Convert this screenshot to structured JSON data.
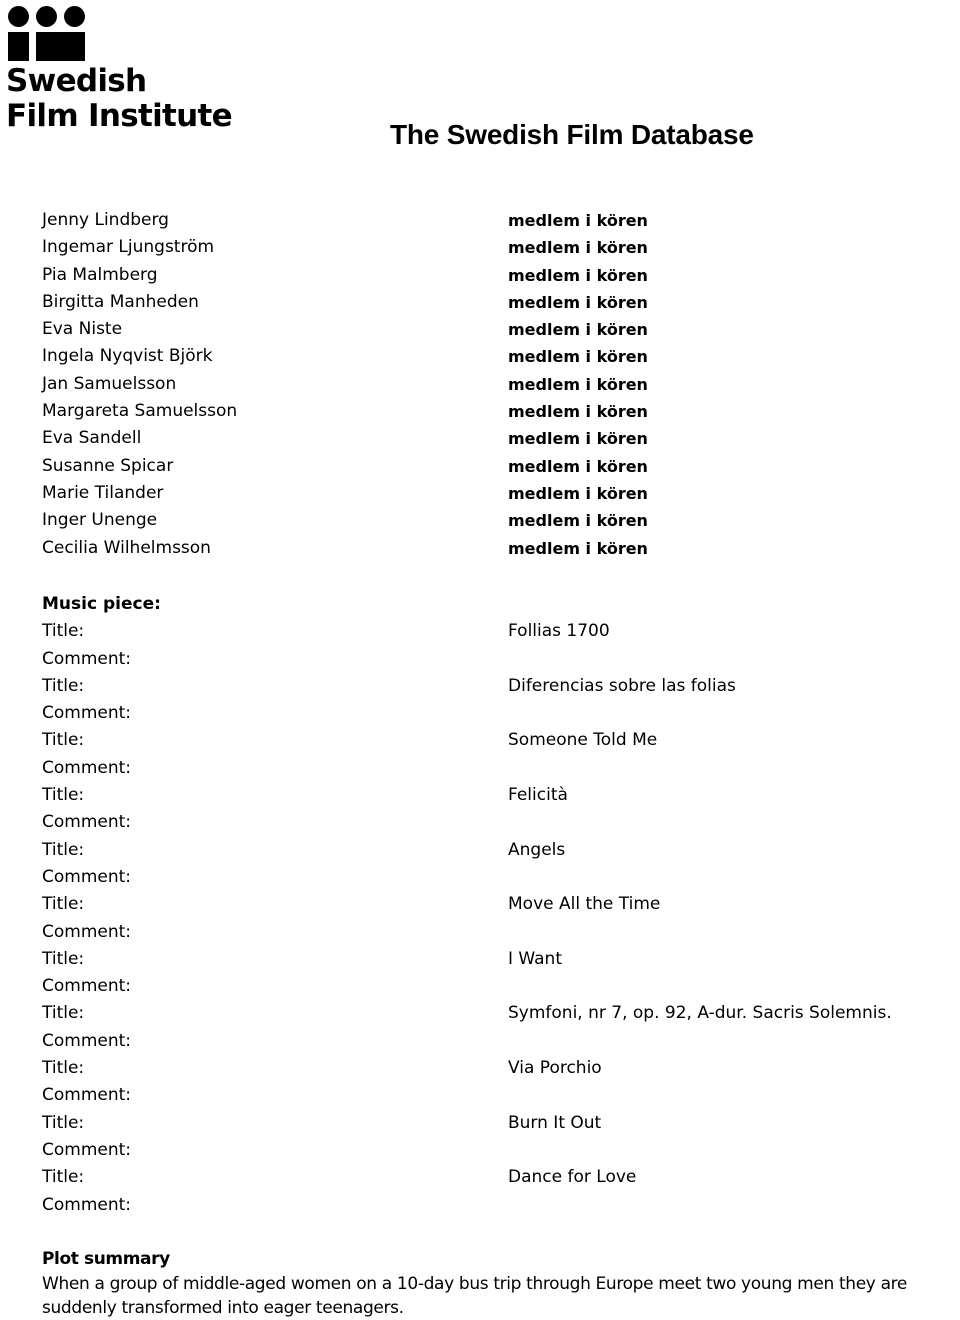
{
  "header": {
    "title": "The Swedish Film Database",
    "logo": {
      "name": "swedish-film-institute-logo",
      "line1": "Swedish",
      "line2": "Film Institute"
    }
  },
  "credits": {
    "rows": [
      {
        "name": "Jenny Lindberg",
        "role": "medlem i kören"
      },
      {
        "name": "Ingemar Ljungström",
        "role": "medlem i kören"
      },
      {
        "name": "Pia Malmberg",
        "role": "medlem i kören"
      },
      {
        "name": "Birgitta Manheden",
        "role": "medlem i kören"
      },
      {
        "name": "Eva Niste",
        "role": "medlem i kören"
      },
      {
        "name": "Ingela Nyqvist Björk",
        "role": "medlem i kören"
      },
      {
        "name": "Jan Samuelsson",
        "role": "medlem i kören"
      },
      {
        "name": "Margareta Samuelsson",
        "role": "medlem i kören"
      },
      {
        "name": "Eva Sandell",
        "role": "medlem i kören"
      },
      {
        "name": "Susanne Spicar",
        "role": "medlem i kören"
      },
      {
        "name": "Marie Tilander",
        "role": "medlem i kören"
      },
      {
        "name": "Inger Unenge",
        "role": "medlem i kören"
      },
      {
        "name": "Cecilia Wilhelmsson",
        "role": "medlem i kören"
      }
    ]
  },
  "music": {
    "heading": "Music piece:",
    "title_label": "Title:",
    "comment_label": "Comment:",
    "pieces": [
      {
        "title": "Follias 1700",
        "comment": ""
      },
      {
        "title": "Diferencias sobre las folias",
        "comment": ""
      },
      {
        "title": "Someone Told Me",
        "comment": ""
      },
      {
        "title": "Felicità",
        "comment": ""
      },
      {
        "title": "Angels",
        "comment": ""
      },
      {
        "title": "Move All the Time",
        "comment": ""
      },
      {
        "title": "I Want",
        "comment": ""
      },
      {
        "title": "Symfoni, nr 7, op. 92, A-dur. Sacris Solemnis.",
        "comment": ""
      },
      {
        "title": "Via Porchio",
        "comment": ""
      },
      {
        "title": "Burn It Out",
        "comment": ""
      },
      {
        "title": "Dance for Love",
        "comment": ""
      }
    ]
  },
  "plot": {
    "heading": "Plot summary",
    "text": "When a group of middle-aged women on a 10-day bus trip through Europe meet two young men they are suddenly transformed into eager teenagers."
  }
}
